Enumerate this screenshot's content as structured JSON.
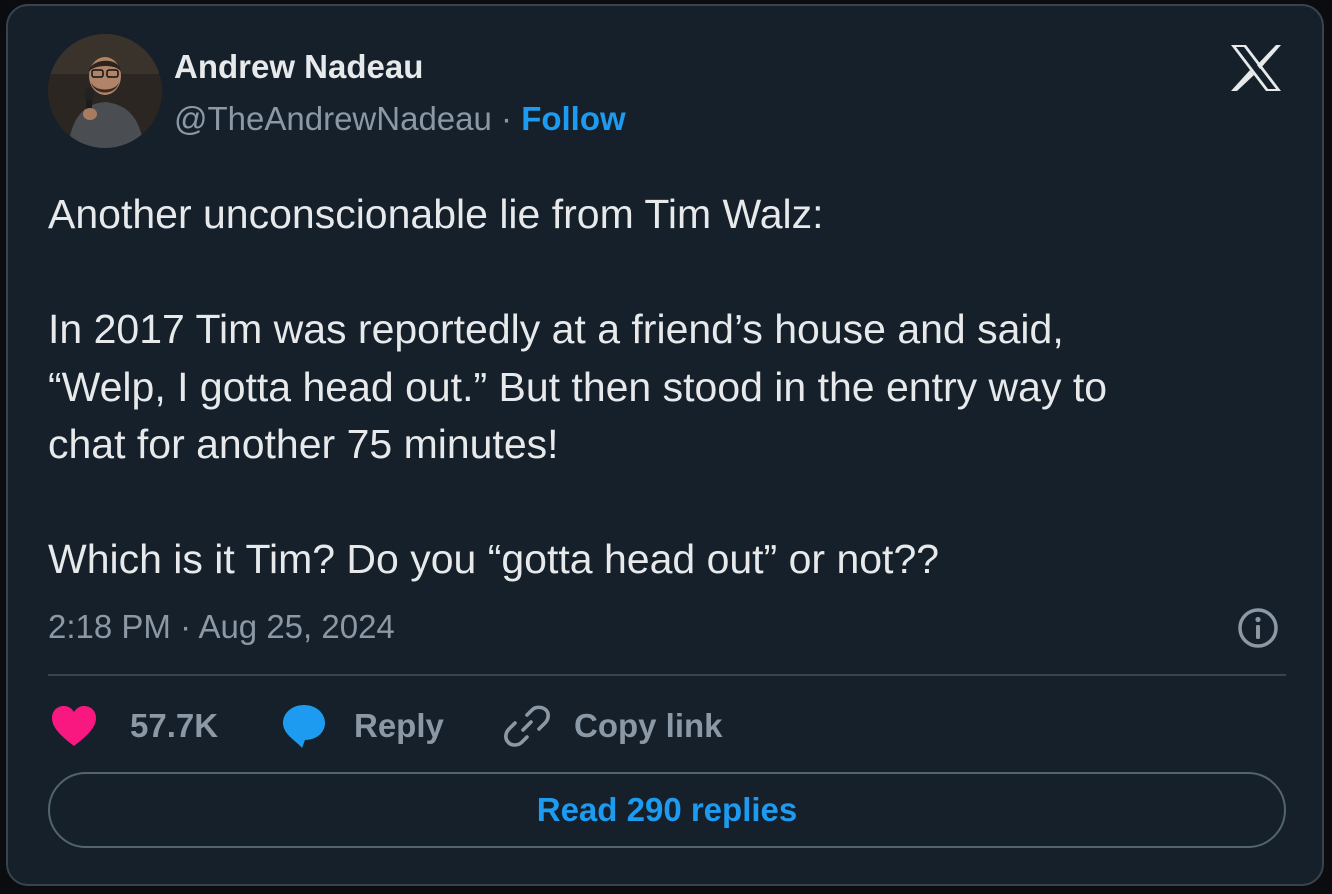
{
  "author": {
    "name": "Andrew Nadeau",
    "handle": "@TheAndrewNadeau",
    "separator": "·",
    "follow_label": "Follow"
  },
  "tweet": {
    "paragraphs": [
      [
        "Another unconscionable lie from Tim Walz:"
      ],
      [
        "In 2017 Tim was reportedly at a friend’s house and said,",
        "“Welp, I gotta head out.” But then stood in the entry way to",
        "chat for another 75 minutes!"
      ],
      [
        "Which is it Tim? Do you “gotta head out” or not??"
      ]
    ],
    "time": "2:18 PM",
    "separator": "·",
    "date": "Aug 25, 2024"
  },
  "actions": {
    "like_count": "57.7K",
    "reply_label": "Reply",
    "copy_link_label": "Copy link"
  },
  "read_replies_label": "Read 290 replies",
  "icons": {
    "platform_logo": "x-logo-icon",
    "info": "info-icon",
    "like": "heart-icon",
    "reply": "speech-bubble-icon",
    "copy_link": "link-icon"
  },
  "colors": {
    "background": "#15202b",
    "accent": "#1d9bf0",
    "like": "#f91880",
    "text_primary": "#e7e9ea",
    "text_secondary": "#8b98a5",
    "border": "#38444d"
  }
}
